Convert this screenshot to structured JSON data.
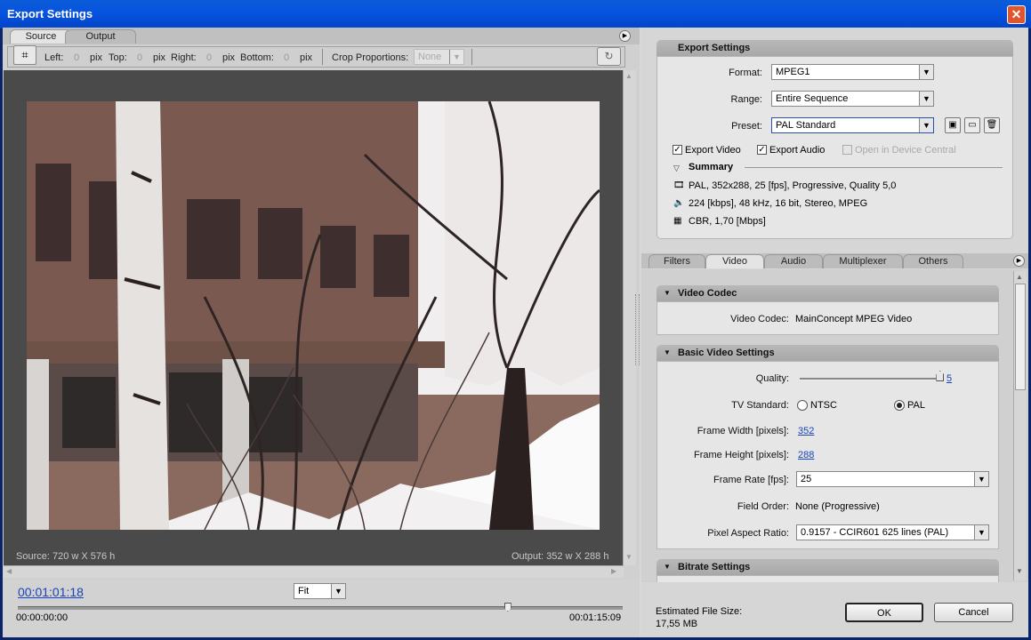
{
  "window": {
    "title": "Export Settings",
    "close_glyph": "✕"
  },
  "left": {
    "tabs": [
      {
        "label": "Source"
      },
      {
        "label": "Output"
      }
    ],
    "crop": {
      "left_label": "Left:",
      "left_value": "0",
      "unit": "pix",
      "top_label": "Top:",
      "top_value": "0",
      "right_label": "Right:",
      "right_value": "0",
      "bottom_label": "Bottom:",
      "bottom_value": "0",
      "proportions_label": "Crop Proportions:",
      "proportions_value": "None"
    },
    "source_info": "Source: 720 w X 576 h",
    "output_info": "Output: 352 w X 288 h",
    "timecode": "00:01:01:18",
    "zoom": "Fit",
    "time_start": "00:00:00:00",
    "time_end": "00:01:15:09",
    "playhead_fraction": 0.81
  },
  "export": {
    "header": "Export Settings",
    "format_label": "Format:",
    "format_value": "MPEG1",
    "range_label": "Range:",
    "range_value": "Entire Sequence",
    "preset_label": "Preset:",
    "preset_value": "PAL Standard",
    "export_video": "Export Video",
    "export_audio": "Export Audio",
    "open_device_central": "Open in Device Central",
    "summary_label": "Summary",
    "summary_video": "PAL, 352x288, 25 [fps], Progressive, Quality 5,0",
    "summary_audio": "224 [kbps], 48 kHz, 16 bit, Stereo, MPEG",
    "summary_bitrate": "CBR, 1,70 [Mbps]"
  },
  "tabs": [
    {
      "label": "Filters"
    },
    {
      "label": "Video"
    },
    {
      "label": "Audio"
    },
    {
      "label": "Multiplexer"
    },
    {
      "label": "Others"
    }
  ],
  "video_codec": {
    "header": "Video Codec",
    "label": "Video Codec:",
    "value": "MainConcept MPEG Video"
  },
  "basic": {
    "header": "Basic Video Settings",
    "quality_label": "Quality:",
    "quality_value": "5",
    "quality_fraction": 0.99,
    "tv_label": "TV Standard:",
    "ntsc": "NTSC",
    "pal": "PAL",
    "fw_label": "Frame Width [pixels]:",
    "fw_value": "352",
    "fh_label": "Frame Height [pixels]:",
    "fh_value": "288",
    "fr_label": "Frame Rate [fps]:",
    "fr_value": "25",
    "fo_label": "Field Order:",
    "fo_value": "None (Progressive)",
    "par_label": "Pixel Aspect Ratio:",
    "par_value": "0.9157 - CCIR601 625 lines (PAL)"
  },
  "bitrate": {
    "header": "Bitrate Settings"
  },
  "footer": {
    "estimated_label": "Estimated File Size:",
    "estimated_value": "17,55 MB",
    "ok": "OK",
    "cancel": "Cancel"
  }
}
